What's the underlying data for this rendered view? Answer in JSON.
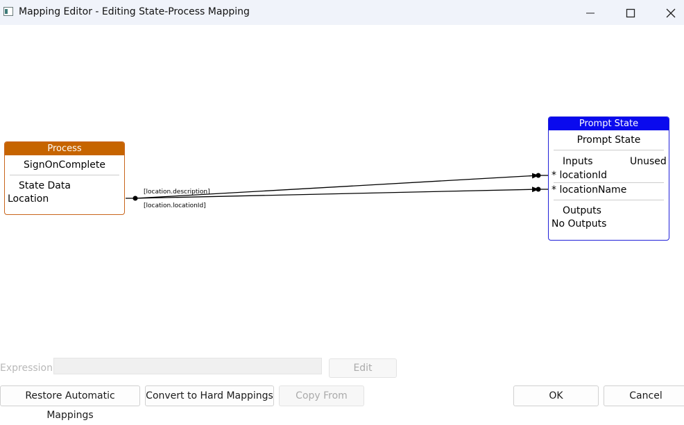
{
  "window": {
    "title": "Mapping Editor - Editing State-Process Mapping",
    "controls": [
      "minimize",
      "maximize",
      "close"
    ]
  },
  "process_node": {
    "header": "Process",
    "name": "SignOnComplete",
    "section": "State Data",
    "items": [
      "Location"
    ],
    "header_color": "#c66400"
  },
  "prompt_node": {
    "header": "Prompt State",
    "name": "Prompt State",
    "inputs_label": "Inputs",
    "unused_label": "Unused",
    "inputs": [
      "* locationId",
      "* locationName"
    ],
    "outputs_label": "Outputs",
    "outputs_value": "No Outputs",
    "header_color": "#0a0aee"
  },
  "mappings": [
    {
      "label": "[location.description]",
      "from": "Location",
      "to": "* locationId"
    },
    {
      "label": "[location.locationId]",
      "from": "Location",
      "to": "* locationName"
    }
  ],
  "expression": {
    "label": "Expression",
    "value": "",
    "edit_button": "Edit"
  },
  "buttons": {
    "restore": "Restore Automatic Mappings",
    "convert": "Convert to Hard Mappings",
    "copy_from": "Copy From",
    "ok": "OK",
    "cancel": "Cancel"
  }
}
